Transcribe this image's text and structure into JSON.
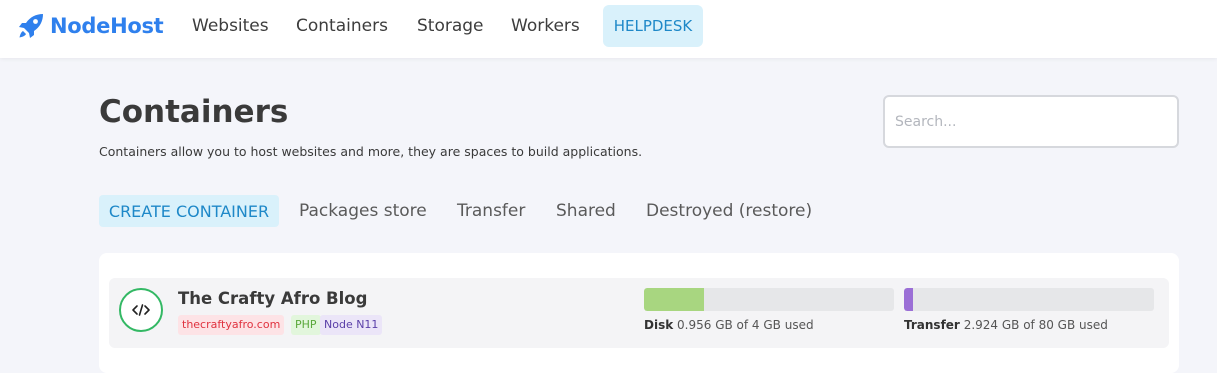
{
  "colors": {
    "brand": "#2f80ed",
    "accent": "#1e88c8",
    "accent_bg": "#d9f1fb",
    "disk_fill": "#a8d680",
    "transfer_fill": "#9b6fd6",
    "icon_ring": "#33b864"
  },
  "brand": {
    "name": "NodeHost",
    "icon": "rocket-icon"
  },
  "nav": {
    "items": [
      {
        "label": "Websites"
      },
      {
        "label": "Containers"
      },
      {
        "label": "Storage"
      },
      {
        "label": "Workers"
      }
    ],
    "helpdesk": "HELPDESK"
  },
  "page": {
    "title": "Containers",
    "description": "Containers allow you to host websites and more, they are spaces to build applications."
  },
  "search": {
    "placeholder": "Search...",
    "value": ""
  },
  "actions": {
    "create": "CREATE CONTAINER",
    "links": [
      {
        "label": "Packages store"
      },
      {
        "label": "Transfer"
      },
      {
        "label": "Shared"
      },
      {
        "label": "Destroyed (restore)"
      }
    ]
  },
  "containers": [
    {
      "icon": "code-icon",
      "name": "The Crafty Afro Blog",
      "badges": {
        "domain": "thecraftyafro.com",
        "runtime": "PHP",
        "node": "Node N11"
      },
      "disk": {
        "label": "Disk",
        "text": "0.956 GB of 4 GB used",
        "fraction": 0.239
      },
      "transfer": {
        "label": "Transfer",
        "text": "2.924 GB of 80 GB used",
        "fraction": 0.037
      }
    }
  ]
}
